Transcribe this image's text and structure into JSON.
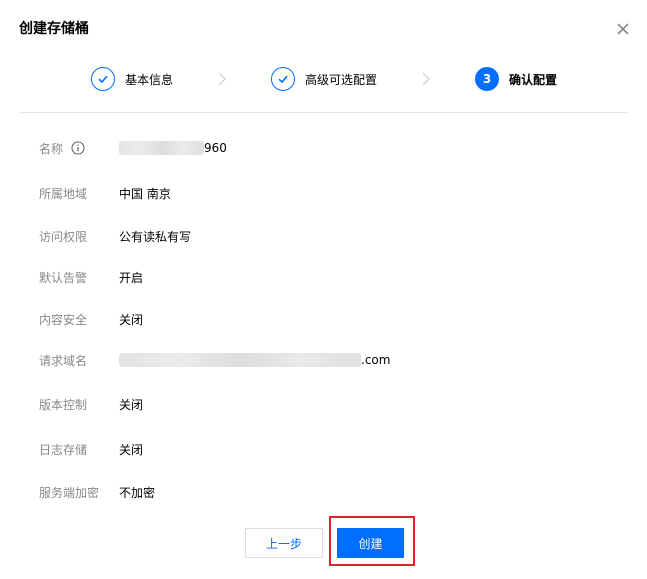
{
  "dialog": {
    "title": "创建存储桶",
    "close_icon": "close-icon"
  },
  "steps": [
    {
      "number": "1",
      "label": "基本信息",
      "status": "done",
      "icon": "check-icon"
    },
    {
      "number": "2",
      "label": "高级可选配置",
      "status": "done",
      "icon": "check-icon"
    },
    {
      "number": "3",
      "label": "确认配置",
      "status": "active"
    }
  ],
  "summary": {
    "name": {
      "label": "名称",
      "value_suffix": "960",
      "icon": "info-icon"
    },
    "region": {
      "label": "所属地域",
      "value": "中国 南京"
    },
    "access": {
      "label": "访问权限",
      "value": "公有读私有写"
    },
    "alert": {
      "label": "默认告警",
      "value": "开启"
    },
    "content_security": {
      "label": "内容安全",
      "value": "关闭"
    },
    "domain": {
      "label": "请求域名",
      "value_suffix": ".com"
    },
    "versioning": {
      "label": "版本控制",
      "value": "关闭"
    },
    "logging": {
      "label": "日志存储",
      "value": "关闭"
    },
    "encryption": {
      "label": "服务端加密",
      "value": "不加密"
    }
  },
  "footer": {
    "prev_label": "上一步",
    "create_label": "创建"
  },
  "colors": {
    "primary": "#006eff",
    "label_gray": "#888888",
    "highlight_red": "#e0242a"
  }
}
